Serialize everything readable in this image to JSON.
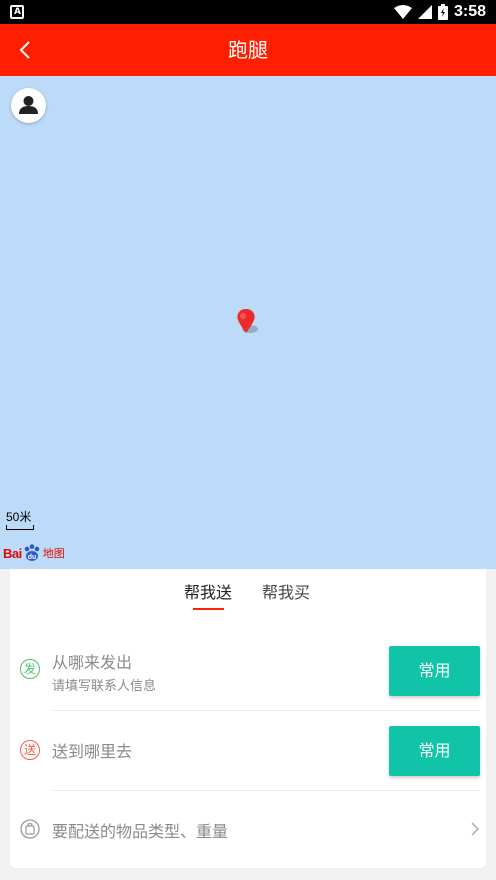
{
  "status_bar": {
    "time": "3:58",
    "notification_icon": "a-square-icon",
    "icons": [
      "wifi-icon",
      "signal-icon",
      "battery-icon"
    ]
  },
  "header": {
    "title": "跑腿",
    "back_icon": "back-arrow-icon",
    "color": "#ff1f00"
  },
  "map": {
    "background": "#bddbf8",
    "scale_label": "50米",
    "logo_text": "Bai",
    "logo_du": "du",
    "logo_suffix": "地图",
    "avatar_icon": "user-icon",
    "marker_icon": "location-pin-icon"
  },
  "tabs": [
    {
      "label": "帮我送",
      "active": true
    },
    {
      "label": "帮我买",
      "active": false
    }
  ],
  "rows": {
    "from": {
      "icon_text": "发",
      "title": "从哪来发出",
      "subtitle": "请填写联系人信息",
      "button": "常用"
    },
    "to": {
      "icon_text": "送",
      "title": "送到哪里去",
      "button": "常用"
    },
    "goods": {
      "icon": "bag-icon",
      "title": "要配送的物品类型、重量",
      "chevron": "chevron-right-icon"
    }
  },
  "colors": {
    "accent": "#ff1f00",
    "button": "#11c3a7",
    "from_icon": "#4cc06a",
    "to_icon": "#ff5a4a"
  }
}
